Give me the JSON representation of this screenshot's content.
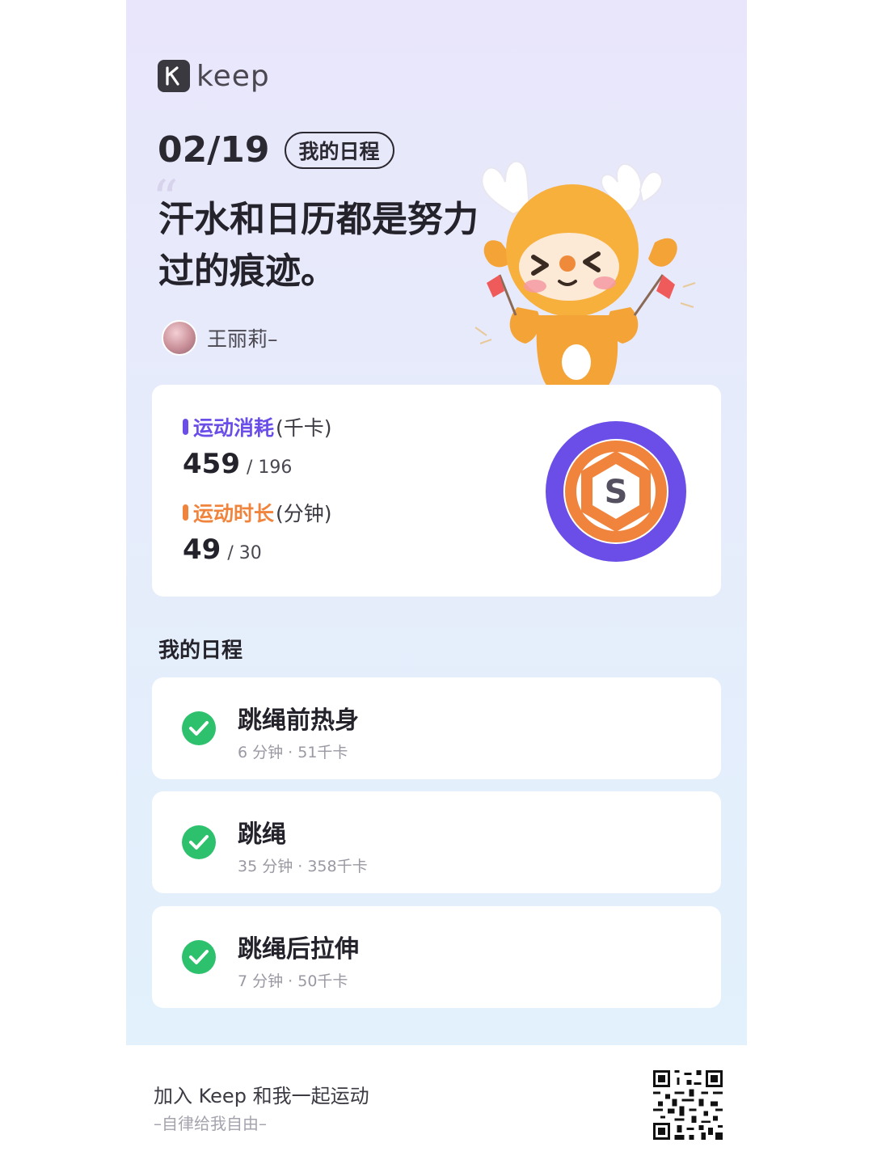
{
  "brand": {
    "logo_letter": "K",
    "name": "keep"
  },
  "header": {
    "date": "02/19",
    "tag": "我的日程"
  },
  "quote": {
    "mark": "“",
    "text": "汗水和日历都是努力过的痕迹。"
  },
  "author": {
    "name": "王丽莉–"
  },
  "stats": {
    "calories": {
      "label": "运动消耗",
      "unit": "(千卡)",
      "value": "459",
      "target": "/ 196",
      "color": "#6b4ee8"
    },
    "duration": {
      "label": "运动时长",
      "unit": "(分钟)",
      "value": "49",
      "target": "/ 30",
      "color": "#f0843c"
    },
    "badge_letter": "S"
  },
  "schedule": {
    "title": "我的日程",
    "items": [
      {
        "title": "跳绳前热身",
        "meta": "6 分钟 · 51千卡",
        "done": true
      },
      {
        "title": "跳绳",
        "meta": "35 分钟 · 358千卡",
        "done": true
      },
      {
        "title": "跳绳后拉伸",
        "meta": "7 分钟 · 50千卡",
        "done": true
      }
    ]
  },
  "footer": {
    "invite": "加入 Keep 和我一起运动",
    "slogan": "–自律给我自由–"
  },
  "colors": {
    "check_green": "#2ec16d",
    "purple": "#6b4ee8",
    "orange": "#f0843c"
  }
}
